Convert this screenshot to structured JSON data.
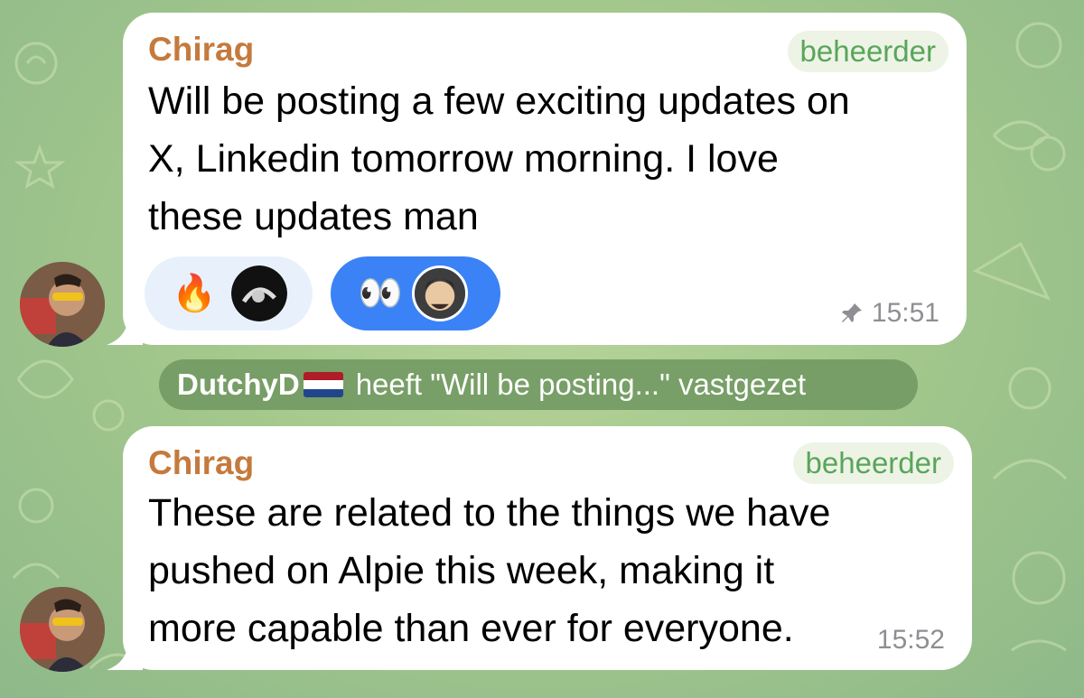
{
  "messages": [
    {
      "sender": "Chirag",
      "role": "beheerder",
      "text": "Will be posting a few exciting updates on\nX, Linkedin tomorrow morning. I love\nthese updates man",
      "time": "15:51",
      "pinned": true,
      "reactions": [
        {
          "emoji": "🔥",
          "selected": false
        },
        {
          "emoji": "👀",
          "selected": true
        }
      ]
    },
    {
      "sender": "Chirag",
      "role": "beheerder",
      "text": "These are related to the things we have\npushed on Alpie this week, making it\nmore capable than ever for everyone.",
      "time": "15:52"
    }
  ],
  "service_message": {
    "actor": "DutchyD",
    "action": "heeft \"Will be posting...\" vastgezet"
  },
  "colors": {
    "sender": "#c57a3d",
    "role_badge": "#5aa55a",
    "reaction_selected": "#3b82f6",
    "reaction_default": "#e8f1fb"
  },
  "icons": {
    "pin": "pin-icon",
    "flag": "netherlands-flag-icon"
  }
}
